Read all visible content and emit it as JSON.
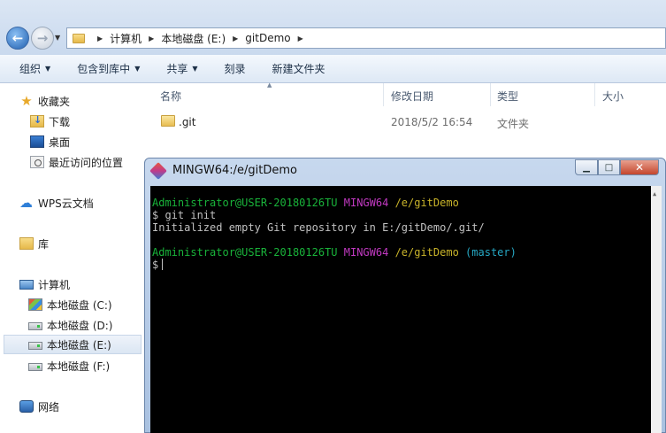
{
  "address": {
    "crumbs": [
      "计算机",
      "本地磁盘 (E:)",
      "gitDemo"
    ]
  },
  "toolbar": {
    "organize": "组织",
    "include_library": "包含到库中",
    "share": "共享",
    "burn": "刻录",
    "new_folder": "新建文件夹"
  },
  "sidebar": {
    "favorites": "收藏夹",
    "downloads": "下载",
    "desktop": "桌面",
    "recent": "最近访问的位置",
    "wps": "WPS云文档",
    "library": "库",
    "computer": "计算机",
    "drive_c": "本地磁盘 (C:)",
    "drive_d": "本地磁盘 (D:)",
    "drive_e": "本地磁盘 (E:)",
    "drive_f": "本地磁盘 (F:)",
    "network": "网络"
  },
  "columns": {
    "name": "名称",
    "modified": "修改日期",
    "type": "类型",
    "size": "大小"
  },
  "files": [
    {
      "name": ".git",
      "modified": "2018/5/2 16:54",
      "type": "文件夹"
    }
  ],
  "terminal": {
    "title": "MINGW64:/e/gitDemo",
    "user_host": "Administrator@USER-20180126TU",
    "env": "MINGW64",
    "path": "/e/gitDemo",
    "cmd": "$ git init",
    "output": "Initialized empty Git repository in E:/gitDemo/.git/",
    "branch": "(master)",
    "prompt": "$"
  },
  "colors": {
    "user_host": "#19b33a",
    "env": "#c23ac2",
    "path": "#c9b42a",
    "branch": "#26a8c4"
  }
}
